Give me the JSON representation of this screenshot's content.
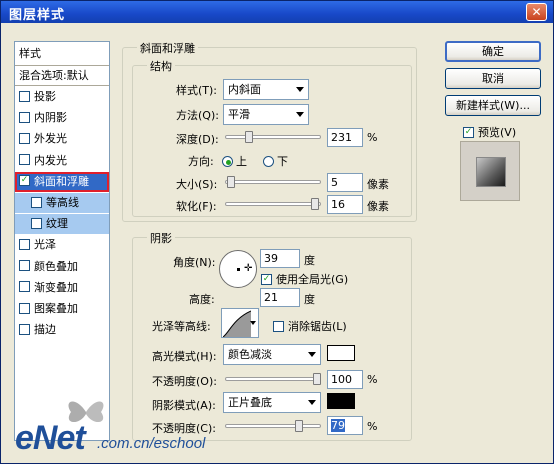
{
  "window": {
    "title": "图层样式",
    "close": "✕"
  },
  "left_list": {
    "header": "样式",
    "items": [
      {
        "label": "混合选项:默认",
        "checkbox": false
      },
      {
        "label": "投影",
        "checkbox": true,
        "checked": false
      },
      {
        "label": "内阴影",
        "checkbox": true,
        "checked": false
      },
      {
        "label": "外发光",
        "checkbox": true,
        "checked": false
      },
      {
        "label": "内发光",
        "checkbox": true,
        "checked": false
      },
      {
        "label": "斜面和浮雕",
        "checkbox": true,
        "checked": true
      },
      {
        "label": "等高线",
        "checkbox": true,
        "checked": false
      },
      {
        "label": "纹理",
        "checkbox": true,
        "checked": false
      },
      {
        "label": "光泽",
        "checkbox": true,
        "checked": false
      },
      {
        "label": "颜色叠加",
        "checkbox": true,
        "checked": false
      },
      {
        "label": "渐变叠加",
        "checkbox": true,
        "checked": false
      },
      {
        "label": "图案叠加",
        "checkbox": true,
        "checked": false
      },
      {
        "label": "描边",
        "checkbox": true,
        "checked": false
      }
    ]
  },
  "bevel": {
    "section": "斜面和浮雕",
    "structure": "结构",
    "style_label": "样式(T):",
    "style_value": "内斜面",
    "technique_label": "方法(Q):",
    "technique_value": "平滑",
    "depth_label": "深度(D):",
    "depth_value": "231",
    "depth_unit": "%",
    "direction_label": "方向:",
    "dir_up": "上",
    "dir_down": "下",
    "size_label": "大小(S):",
    "size_value": "5",
    "size_unit": "像素",
    "soften_label": "软化(F):",
    "soften_value": "16",
    "soften_unit": "像素",
    "sliders": {
      "depth": 0.23,
      "size": 0.02,
      "soften": 0.98
    }
  },
  "shading": {
    "section": "阴影",
    "angle_label": "角度(N):",
    "angle_value": "39",
    "angle_unit": "度",
    "global_light": "使用全局光(G)",
    "altitude_label": "高度:",
    "altitude_value": "21",
    "altitude_unit": "度",
    "gloss_label": "光泽等高线:",
    "antialias": "消除锯齿(L)",
    "highlight_label": "高光模式(H):",
    "highlight_value": "颜色减淡",
    "highlight_color": "#FFFFFF",
    "hl_opacity_label": "不透明度(O):",
    "hl_opacity_value": "100",
    "hl_opacity_unit": "%",
    "shadow_label": "阴影模式(A):",
    "shadow_value": "正片叠底",
    "shadow_color": "#000000",
    "sh_opacity_label": "不透明度(C):",
    "sh_opacity_value": "79",
    "sh_opacity_unit": "%",
    "sliders": {
      "hl_opacity": 1.0,
      "sh_opacity": 0.79
    }
  },
  "buttons": {
    "ok": "确定",
    "cancel": "取消",
    "new_style": "新建样式(W)...",
    "preview": "预览(V)"
  },
  "watermark": {
    "logo": "eNet",
    "url": ".com.cn/eschool"
  }
}
